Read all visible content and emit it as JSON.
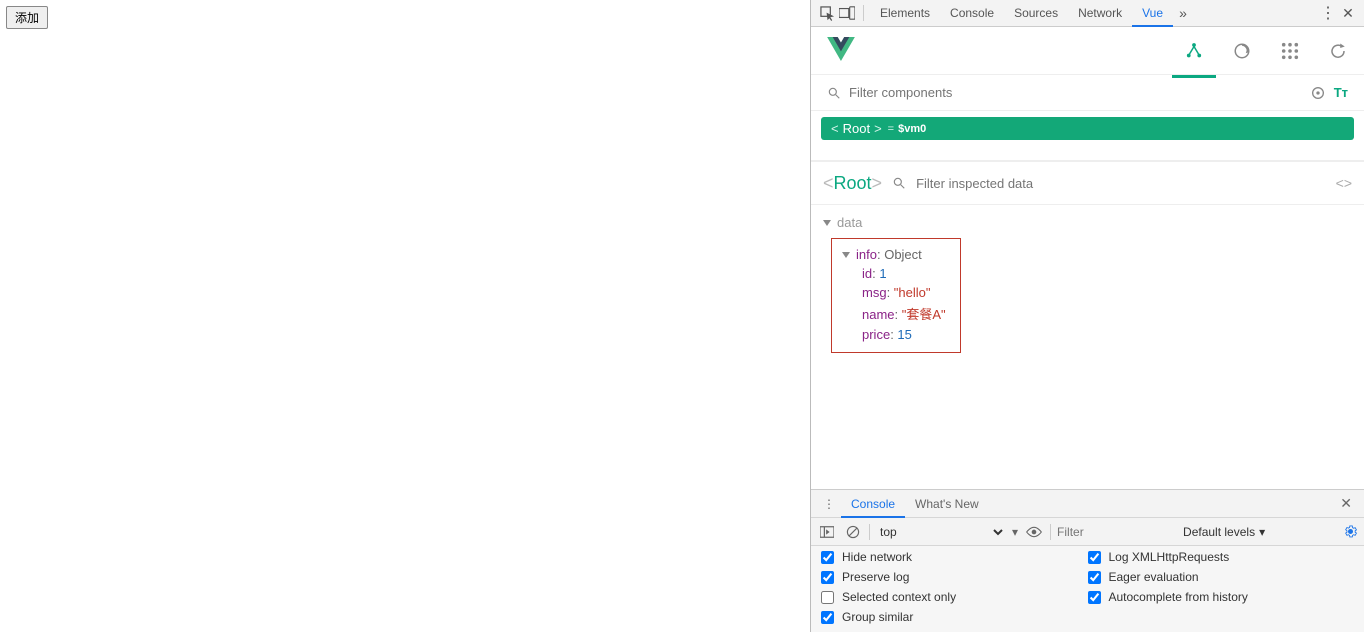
{
  "page": {
    "add_button": "添加"
  },
  "devtools_tabs": {
    "elements": "Elements",
    "console": "Console",
    "sources": "Sources",
    "network": "Network",
    "vue": "Vue"
  },
  "component_filter": {
    "placeholder": "Filter components"
  },
  "tree": {
    "root_label": "Root",
    "eq": "=",
    "vm_ref": "$vm0"
  },
  "inspector": {
    "title": "Root",
    "filter_placeholder": "Filter inspected data",
    "section_label": "data",
    "info_key": "info",
    "info_type": "Object",
    "props": {
      "id_key": "id",
      "id_val": "1",
      "msg_key": "msg",
      "msg_val": "\"hello\"",
      "name_key": "name",
      "name_val": "\"套餐A\"",
      "price_key": "price",
      "price_val": "15"
    }
  },
  "console": {
    "tab_console": "Console",
    "tab_whatsnew": "What's New",
    "context": "top",
    "filter_placeholder": "Filter",
    "levels_label": "Default levels",
    "opts": {
      "hide_network": "Hide network",
      "preserve_log": "Preserve log",
      "selected_context": "Selected context only",
      "group_similar": "Group similar",
      "log_xhr": "Log XMLHttpRequests",
      "eager_eval": "Eager evaluation",
      "autocomplete": "Autocomplete from history"
    },
    "checked": {
      "hide_network": true,
      "preserve_log": true,
      "selected_context": false,
      "group_similar": true,
      "log_xhr": true,
      "eager_eval": true,
      "autocomplete": true
    }
  }
}
